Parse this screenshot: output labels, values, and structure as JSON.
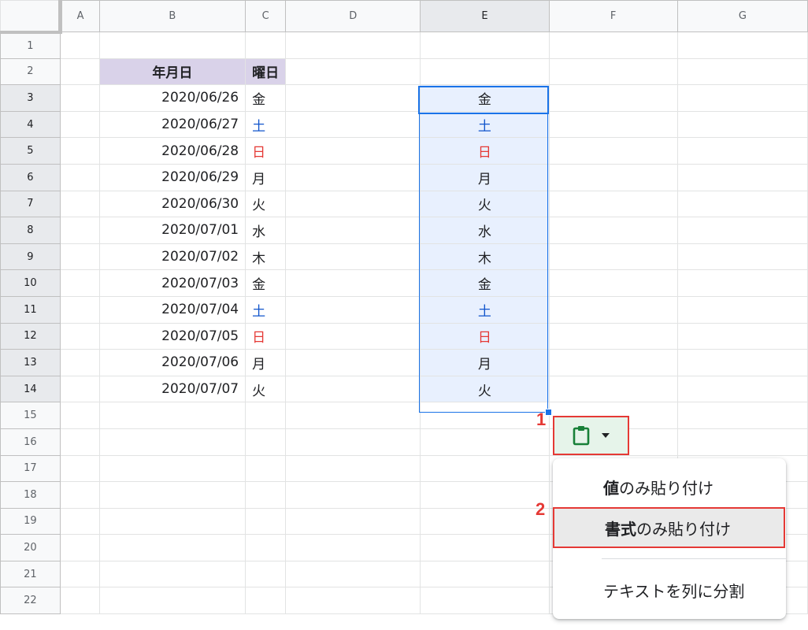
{
  "columns": [
    "A",
    "B",
    "C",
    "D",
    "E",
    "F",
    "G"
  ],
  "selected_column": "E",
  "rows": [
    "1",
    "2",
    "3",
    "4",
    "5",
    "6",
    "7",
    "8",
    "9",
    "10",
    "11",
    "12",
    "13",
    "14",
    "15",
    "16",
    "17",
    "18",
    "19",
    "20",
    "21",
    "22"
  ],
  "selected_rows": [
    "3",
    "4",
    "5",
    "6",
    "7",
    "8",
    "9",
    "10",
    "11",
    "12",
    "13",
    "14"
  ],
  "header_row": {
    "date": "年月日",
    "weekday": "曜日"
  },
  "data_rows": [
    {
      "date": "2020/06/26",
      "weekday": "金",
      "color": "#202124"
    },
    {
      "date": "2020/06/27",
      "weekday": "土",
      "color": "#1155cc"
    },
    {
      "date": "2020/06/28",
      "weekday": "日",
      "color": "#e53935"
    },
    {
      "date": "2020/06/29",
      "weekday": "月",
      "color": "#202124"
    },
    {
      "date": "2020/06/30",
      "weekday": "火",
      "color": "#202124"
    },
    {
      "date": "2020/07/01",
      "weekday": "水",
      "color": "#202124"
    },
    {
      "date": "2020/07/02",
      "weekday": "木",
      "color": "#202124"
    },
    {
      "date": "2020/07/03",
      "weekday": "金",
      "color": "#202124"
    },
    {
      "date": "2020/07/04",
      "weekday": "土",
      "color": "#1155cc"
    },
    {
      "date": "2020/07/05",
      "weekday": "日",
      "color": "#e53935"
    },
    {
      "date": "2020/07/06",
      "weekday": "月",
      "color": "#202124"
    },
    {
      "date": "2020/07/07",
      "weekday": "火",
      "color": "#202124"
    }
  ],
  "pasted_column": [
    "金",
    "土",
    "日",
    "月",
    "火",
    "水",
    "木",
    "金",
    "土",
    "日",
    "月",
    "火"
  ],
  "paste_options": {
    "icon": "clipboard-icon",
    "caret": "caret-down-icon",
    "items": [
      {
        "bold": "値",
        "rest": "のみ貼り付け"
      },
      {
        "bold": "書式",
        "rest": "のみ貼り付け"
      },
      {
        "bold": "",
        "rest": "テキストを列に分割"
      }
    ]
  },
  "steps": [
    "1",
    "2"
  ],
  "colors": {
    "selection": "#1a73e8",
    "selection_fill": "#e8f0fe",
    "header_fill": "#d9d2e9",
    "annotation": "#e53935",
    "paste_button_fill": "#e6f4ea",
    "clipboard_icon": "#188038"
  }
}
